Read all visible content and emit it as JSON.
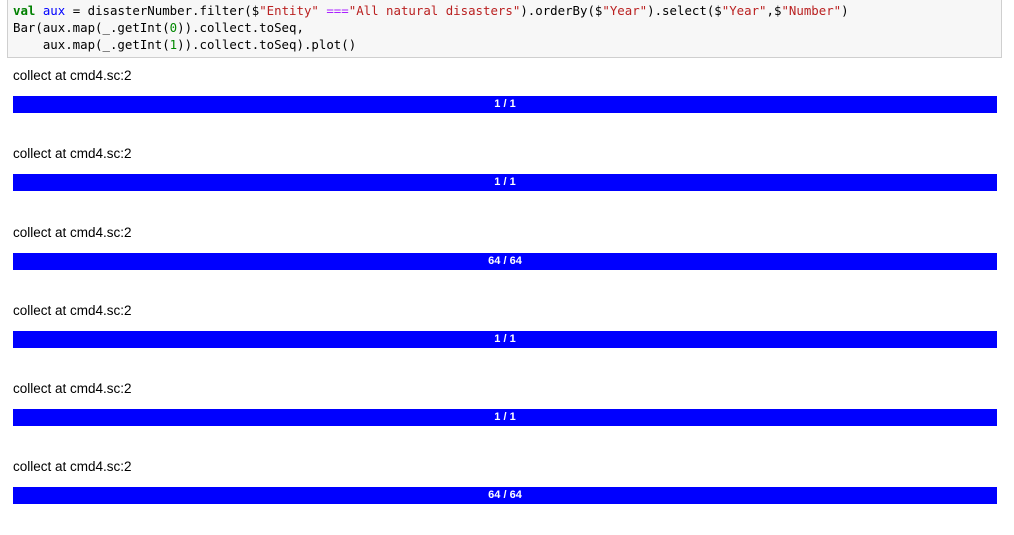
{
  "code": {
    "line1": {
      "kw": "val",
      "var": " aux",
      "p1": " = disasterNumber.filter($",
      "s1": "\"Entity\"",
      "op": " ===",
      "s2": "\"All natural disasters\"",
      "p2": ").orderBy($",
      "s3": "\"Year\"",
      "p3": ").select($",
      "s4": "\"Year\"",
      "p4": ",$",
      "s5": "\"Number\"",
      "p5": ")"
    },
    "line2": {
      "p1": "Bar(aux.map(_.getInt(",
      "n": "0",
      "p2": ")).collect.toSeq,"
    },
    "line3": {
      "p1": "    aux.map(_.getInt(",
      "n": "1",
      "p2": ")).collect.toSeq).plot()"
    }
  },
  "jobs": [
    {
      "label": "collect at cmd4.sc:2",
      "progress_text": "1 / 1",
      "progress": 1.0
    },
    {
      "label": "collect at cmd4.sc:2",
      "progress_text": "1 / 1",
      "progress": 1.0
    },
    {
      "label": "collect at cmd4.sc:2",
      "progress_text": "64 / 64",
      "progress": 1.0
    },
    {
      "label": "collect at cmd4.sc:2",
      "progress_text": "1 / 1",
      "progress": 1.0
    },
    {
      "label": "collect at cmd4.sc:2",
      "progress_text": "1 / 1",
      "progress": 1.0
    },
    {
      "label": "collect at cmd4.sc:2",
      "progress_text": "64 / 64",
      "progress": 1.0
    }
  ],
  "colors": {
    "bar_fill": "#0000ff",
    "bar_text": "#ffffff",
    "code_bg": "#f7f7f7"
  }
}
